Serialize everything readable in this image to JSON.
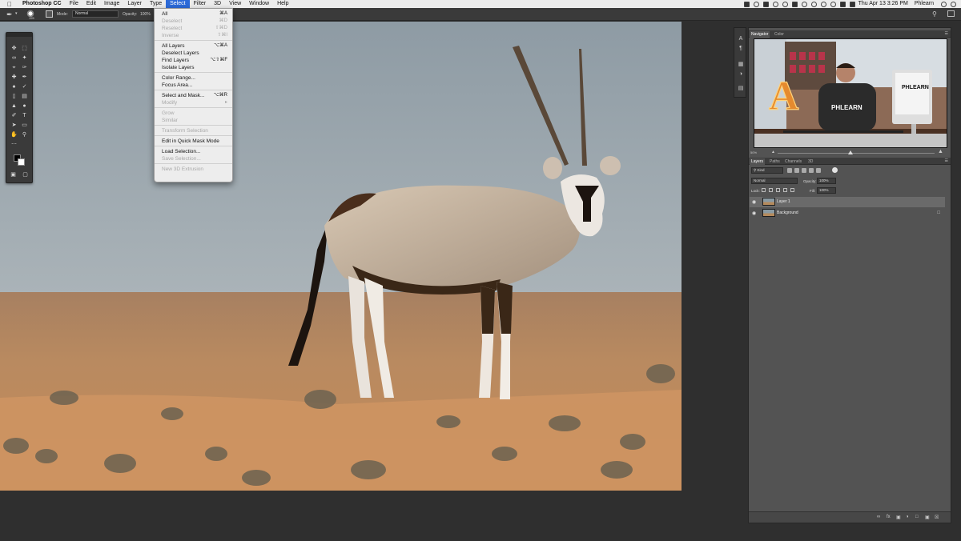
{
  "menubar": {
    "apple_icon": "apple-icon",
    "items": [
      "Photoshop CC",
      "File",
      "Edit",
      "Image",
      "Layer",
      "Type",
      "Select",
      "Filter",
      "3D",
      "View",
      "Window",
      "Help"
    ],
    "active_item": "Select",
    "clock": "Thu Apr 13  3:26 PM",
    "user": "Phlearn"
  },
  "options_bar": {
    "size_value": "195",
    "mode_label": "Mode:",
    "mode_value": "Normal",
    "opacity_label": "Opacity:",
    "opacity_value": "100%"
  },
  "select_menu": {
    "groups": [
      [
        {
          "label": "All",
          "shortcut": "⌘A",
          "enabled": true
        },
        {
          "label": "Deselect",
          "shortcut": "⌘D",
          "enabled": false
        },
        {
          "label": "Reselect",
          "shortcut": "⇧⌘D",
          "enabled": false
        },
        {
          "label": "Inverse",
          "shortcut": "⇧⌘I",
          "enabled": false
        }
      ],
      [
        {
          "label": "All Layers",
          "shortcut": "⌥⌘A",
          "enabled": true
        },
        {
          "label": "Deselect Layers",
          "shortcut": "",
          "enabled": true
        },
        {
          "label": "Find Layers",
          "shortcut": "⌥⇧⌘F",
          "enabled": true
        },
        {
          "label": "Isolate Layers",
          "shortcut": "",
          "enabled": true
        }
      ],
      [
        {
          "label": "Color Range...",
          "shortcut": "",
          "enabled": true
        },
        {
          "label": "Focus Area...",
          "shortcut": "",
          "enabled": true
        }
      ],
      [
        {
          "label": "Select and Mask...",
          "shortcut": "⌥⌘R",
          "enabled": true
        },
        {
          "label": "Modify",
          "shortcut": "▸",
          "enabled": false
        }
      ],
      [
        {
          "label": "Grow",
          "shortcut": "",
          "enabled": false
        },
        {
          "label": "Similar",
          "shortcut": "",
          "enabled": false
        }
      ],
      [
        {
          "label": "Transform Selection",
          "shortcut": "",
          "enabled": false
        }
      ],
      [
        {
          "label": "Edit in Quick Mask Mode",
          "shortcut": "",
          "enabled": true
        }
      ],
      [
        {
          "label": "Load Selection...",
          "shortcut": "",
          "enabled": true
        },
        {
          "label": "Save Selection...",
          "shortcut": "",
          "enabled": false
        }
      ],
      [
        {
          "label": "New 3D Extrusion",
          "shortcut": "",
          "enabled": false
        }
      ]
    ]
  },
  "navigator": {
    "tabs": [
      "Navigator",
      "Color"
    ],
    "active_tab": "Navigator",
    "zoom": "50%",
    "thumbnail_signage": {
      "letter": "A",
      "shirt": "PHLEARN",
      "monitor": "PHLEARN"
    }
  },
  "layers_panel": {
    "tabs": [
      "Layers",
      "Paths",
      "Channels",
      "3D"
    ],
    "active_tab": "Layers",
    "filter_kind": "Kind",
    "blend_mode": "Normal",
    "opacity_label": "Opacity:",
    "opacity_value": "100%",
    "lock_label": "Lock:",
    "fill_label": "Fill:",
    "fill_value": "100%",
    "layers": [
      {
        "name": "Layer 1",
        "selected": true,
        "visible": true,
        "locked": false
      },
      {
        "name": "Background",
        "selected": false,
        "visible": true,
        "locked": true
      }
    ]
  },
  "colors": {
    "menubar_active": "#2c6ad8",
    "panel_bg": "#535353",
    "workspace_bg": "#2f2f2f",
    "sky": "#9aa7af",
    "sand": "#c08a5d"
  }
}
